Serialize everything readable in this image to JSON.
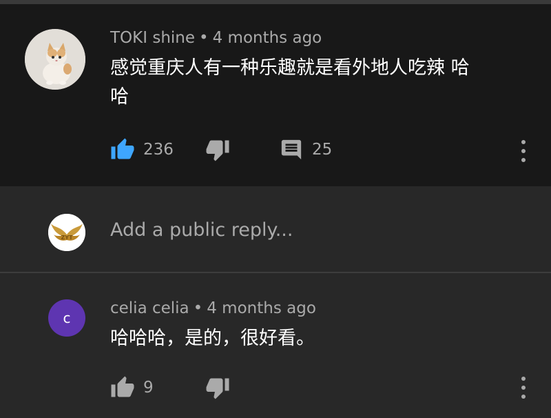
{
  "comment1": {
    "author": "TOKI shine",
    "separator": "•",
    "time": "4 months ago",
    "text_line1": "感觉重庆人有一种乐趣就是看外地人吃辣 哈",
    "text_line2": "哈",
    "likes": "236",
    "replies": "25",
    "like_active_color": "#3ea6ff",
    "avatar_icon": "cat-photo-avatar"
  },
  "reply_box": {
    "placeholder": "Add a public reply...",
    "avatar_icon": "winged-logo-avatar",
    "avatar_text": "ZYT"
  },
  "comment2": {
    "author": "celia celia",
    "separator": "•",
    "time": "4 months ago",
    "text": "哈哈哈，是的，很好看。",
    "likes": "9",
    "avatar_letter": "c",
    "avatar_color": "#5e35b1"
  }
}
